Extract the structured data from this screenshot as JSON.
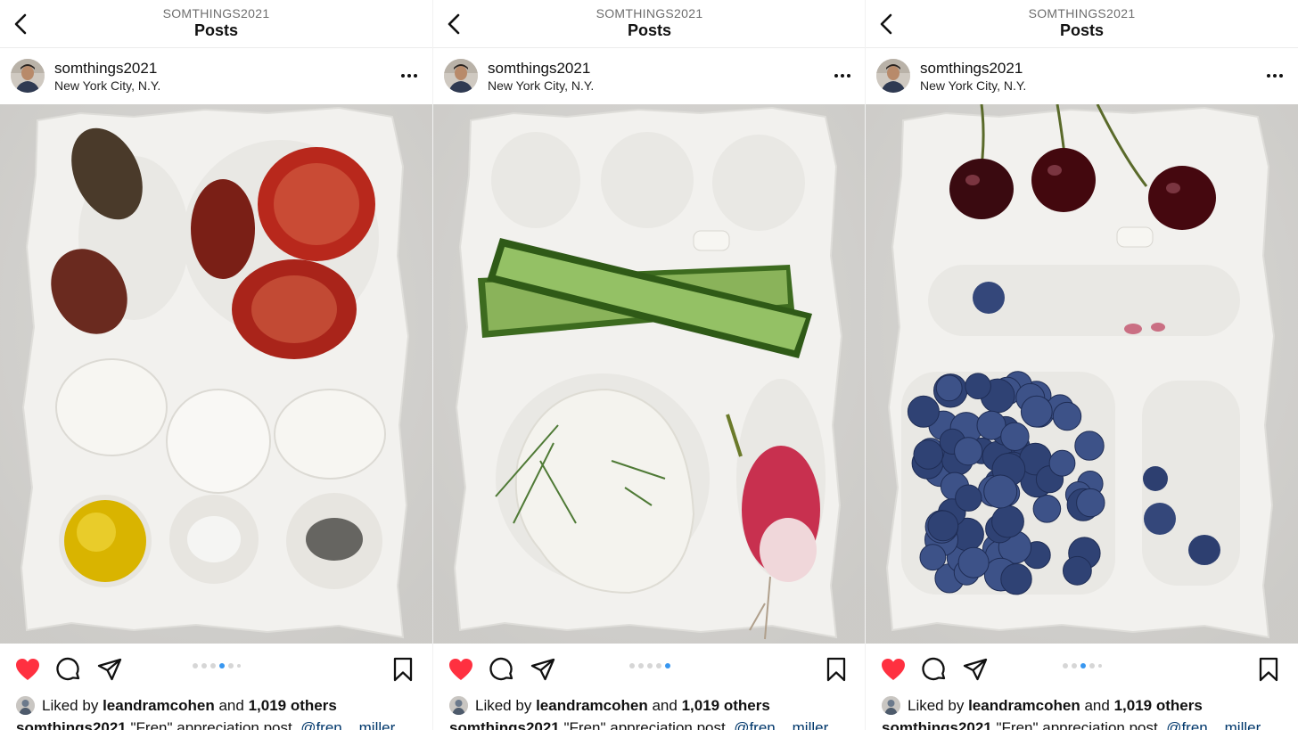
{
  "posts": [
    {
      "profile_label": "SOMTHINGS2021",
      "screen_title": "Posts",
      "username": "somthings2021",
      "location": "New York City, N.Y.",
      "likes_prefix": "Liked by",
      "liked_by": "leandramcohen",
      "likes_joiner": "and",
      "likes_others": "1,019 others",
      "caption_user": "somthings2021",
      "caption_text": "\"Fren\" appreciation post.",
      "caption_mention": "@fren__miller",
      "carousel_dots": 6,
      "carousel_active_index": 3,
      "liked": true
    },
    {
      "profile_label": "SOMTHINGS2021",
      "screen_title": "Posts",
      "username": "somthings2021",
      "location": "New York City, N.Y.",
      "likes_prefix": "Liked by",
      "liked_by": "leandramcohen",
      "likes_joiner": "and",
      "likes_others": "1,019 others",
      "caption_user": "somthings2021",
      "caption_text": "\"Fren\" appreciation post.",
      "caption_mention": "@fren__miller",
      "carousel_dots": 5,
      "carousel_active_index": 4,
      "liked": true
    },
    {
      "profile_label": "SOMTHINGS2021",
      "screen_title": "Posts",
      "username": "somthings2021",
      "location": "New York City, N.Y.",
      "likes_prefix": "Liked by",
      "liked_by": "leandramcohen",
      "likes_joiner": "and",
      "likes_others": "1,019 others",
      "caption_user": "somthings2021",
      "caption_text": "\"Fren\" appreciation post.",
      "caption_mention": "@fren__miller",
      "carousel_dots": 5,
      "carousel_active_index": 2,
      "liked": true
    }
  ],
  "icons": {
    "back": "chevron-left-icon",
    "more": "more-horizontal-icon",
    "like": "heart-icon",
    "comment": "comment-icon",
    "share": "send-icon",
    "save": "bookmark-icon"
  },
  "colors": {
    "like_red": "#ff3040",
    "carousel_active": "#3897f0",
    "mention_blue": "#00376b"
  },
  "photos": [
    {
      "content": "ceramic tray with tomatoes, mozzarella, olive oil, salt and pepper"
    },
    {
      "content": "ceramic tray with cucumber spears, tzatziki with dill and a radish"
    },
    {
      "content": "ceramic tray with cherries and blueberries"
    }
  ]
}
